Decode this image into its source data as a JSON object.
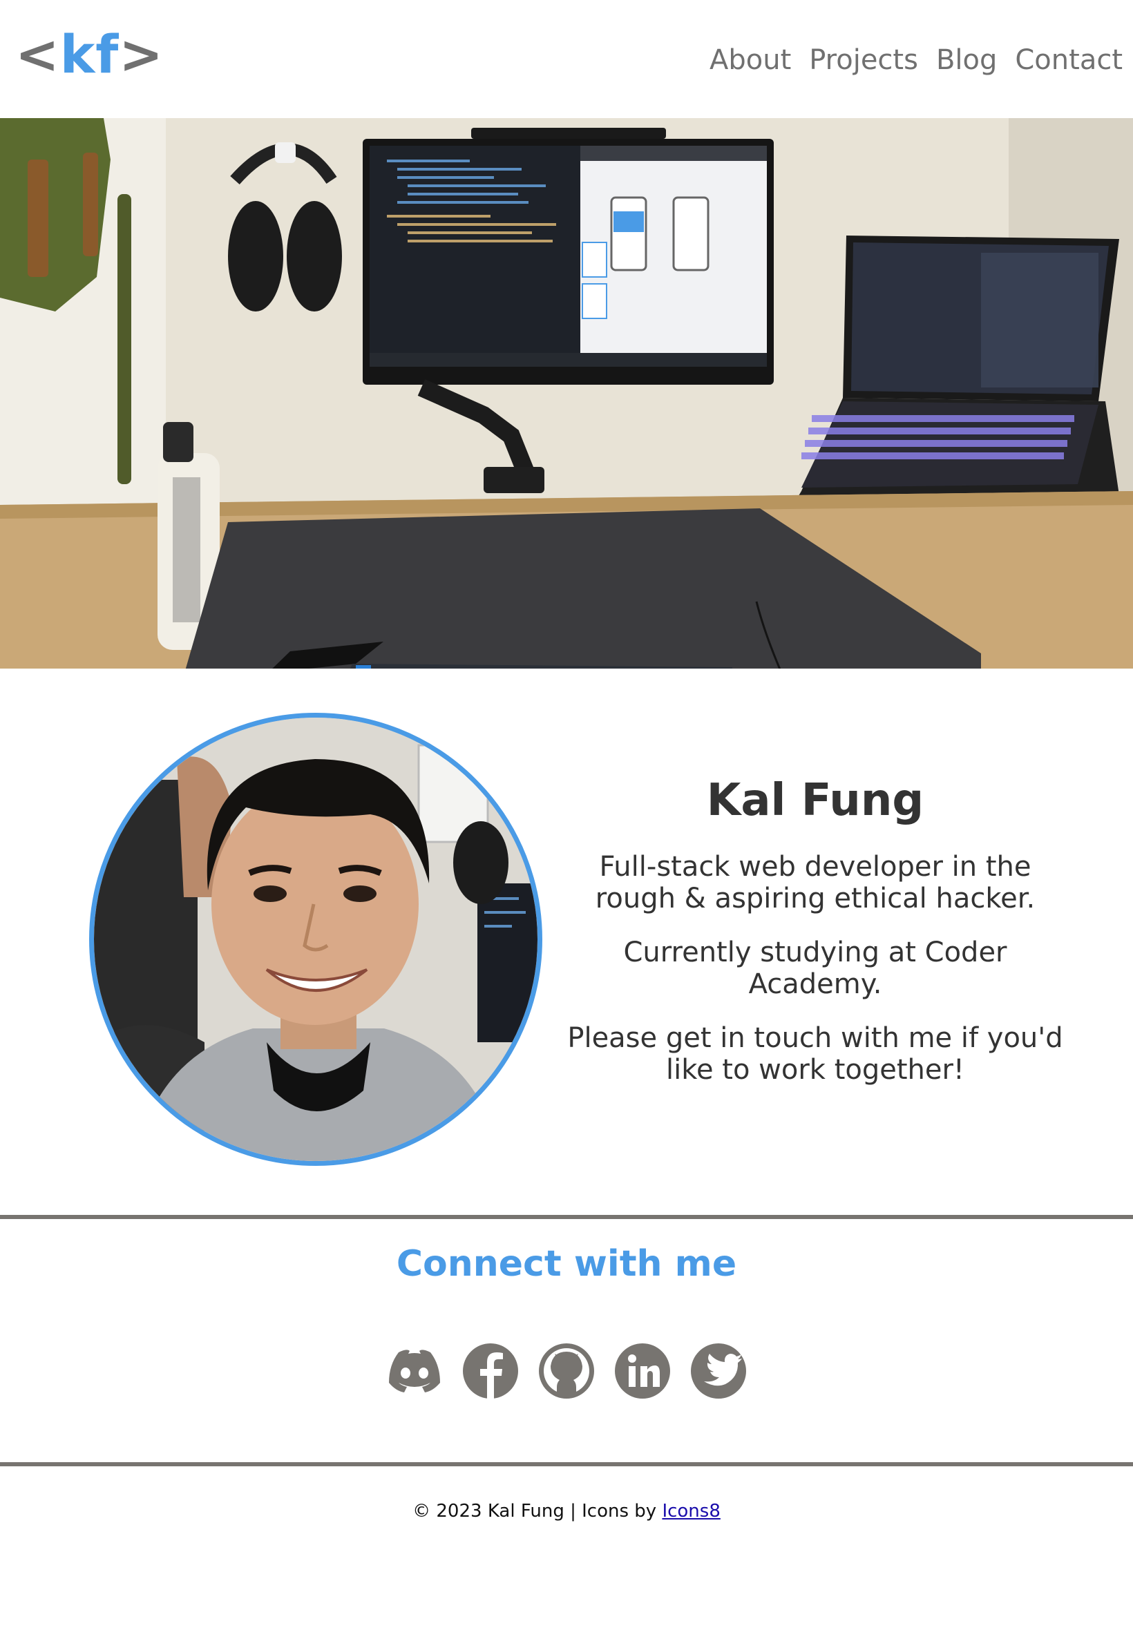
{
  "header": {
    "logo": {
      "open": "<",
      "text": "kf",
      "close": ">"
    },
    "nav": [
      {
        "label": "About"
      },
      {
        "label": "Projects"
      },
      {
        "label": "Blog"
      },
      {
        "label": "Contact"
      }
    ]
  },
  "about": {
    "name": "Kal Fung",
    "paragraphs": [
      "Full-stack web developer in the rough & aspiring ethical hacker.",
      "Currently studying at Coder Academy.",
      "Please get in touch with me if you'd like to work together!"
    ]
  },
  "connect": {
    "title": "Connect with me",
    "icons": [
      "discord-icon",
      "facebook-icon",
      "github-icon",
      "linkedin-icon",
      "twitter-icon"
    ]
  },
  "footer": {
    "text": "© 2023 Kal Fung | Icons by ",
    "link": "Icons8"
  },
  "colors": {
    "accent": "#4a9be6",
    "grey": "#707070",
    "text": "#333333",
    "divider": "#777470"
  }
}
